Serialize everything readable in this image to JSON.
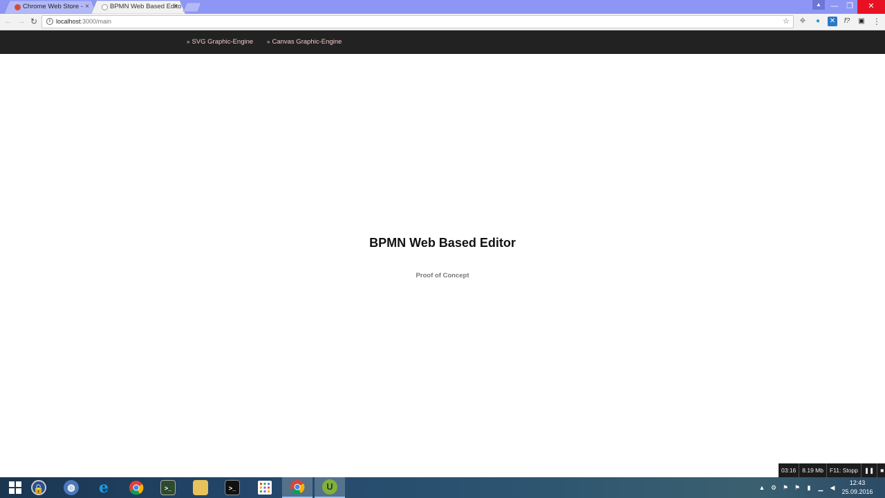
{
  "browser": {
    "tabs": [
      {
        "title": "Chrome Web Store - ",
        "close": "×"
      },
      {
        "title": "BPMN Web Based Edito",
        "close": "×"
      }
    ],
    "window_controls": {
      "minimize": "—",
      "maximize": "❐",
      "close": "✕"
    },
    "nav": {
      "back": "←",
      "forward": "→",
      "reload": "↻"
    },
    "address": {
      "host": "localhost",
      "path": ":3000/main"
    },
    "bookmark_star": "☆",
    "menu": "⋮",
    "extensions": [
      {
        "icon": "move-icon",
        "glyph": "✥",
        "color": "#888888"
      },
      {
        "icon": "globe-extension-icon",
        "glyph": "●",
        "color": "#1f9ad6"
      },
      {
        "icon": "x-extension-icon",
        "glyph": "✕",
        "color": "#2979c6"
      },
      {
        "icon": "function-extension-icon",
        "glyph": "f?",
        "color": "#444444"
      },
      {
        "icon": "screen-extension-icon",
        "glyph": "▣",
        "color": "#222222"
      }
    ],
    "profile_icon": "▲"
  },
  "page": {
    "nav_links": [
      {
        "label": "SVG Graphic-Engine",
        "chevron": "»"
      },
      {
        "label": "Canvas Graphic-Engine",
        "chevron": "»"
      }
    ],
    "title": "BPMN Web Based Editor",
    "subtitle": "Proof of Concept"
  },
  "recorder": {
    "time": "03:16",
    "size": "8.19 Mb",
    "hint": "F11: Stopp",
    "pause": "❚❚",
    "stop": "■"
  },
  "taskbar": {
    "items": [
      {
        "icon": "windows-start-icon",
        "glyph": "⊞",
        "color": "transparent"
      },
      {
        "icon": "lock-app-icon",
        "glyph": "🔒",
        "color": "#2b4c8c"
      },
      {
        "icon": "globe-app-icon",
        "glyph": "◍",
        "color": "#4b79b8"
      },
      {
        "icon": "internet-explorer-icon",
        "glyph": "e",
        "color": "#1c7fd6"
      },
      {
        "icon": "chrome-icon",
        "glyph": "◉",
        "color": "#db4437"
      },
      {
        "icon": "terminal-green-icon",
        "glyph": ">_",
        "color": "#2d4a2d"
      },
      {
        "icon": "file-explorer-icon",
        "glyph": "▭",
        "color": "#e8c25a"
      },
      {
        "icon": "command-prompt-icon",
        "glyph": ">_",
        "color": "#111111"
      },
      {
        "icon": "apps-grid-icon",
        "glyph": "▦",
        "color": "#ffffff"
      },
      {
        "icon": "chrome-active-icon",
        "glyph": "◉",
        "color": "#db4437"
      },
      {
        "icon": "recorder-app-icon",
        "glyph": "U",
        "color": "#7fb03a"
      }
    ],
    "tray": [
      "▲",
      "⚙",
      "⚑",
      "⚑",
      "▮",
      "▁",
      "◀"
    ],
    "clock": {
      "time": "12:43",
      "date": "25.09.2016"
    }
  }
}
